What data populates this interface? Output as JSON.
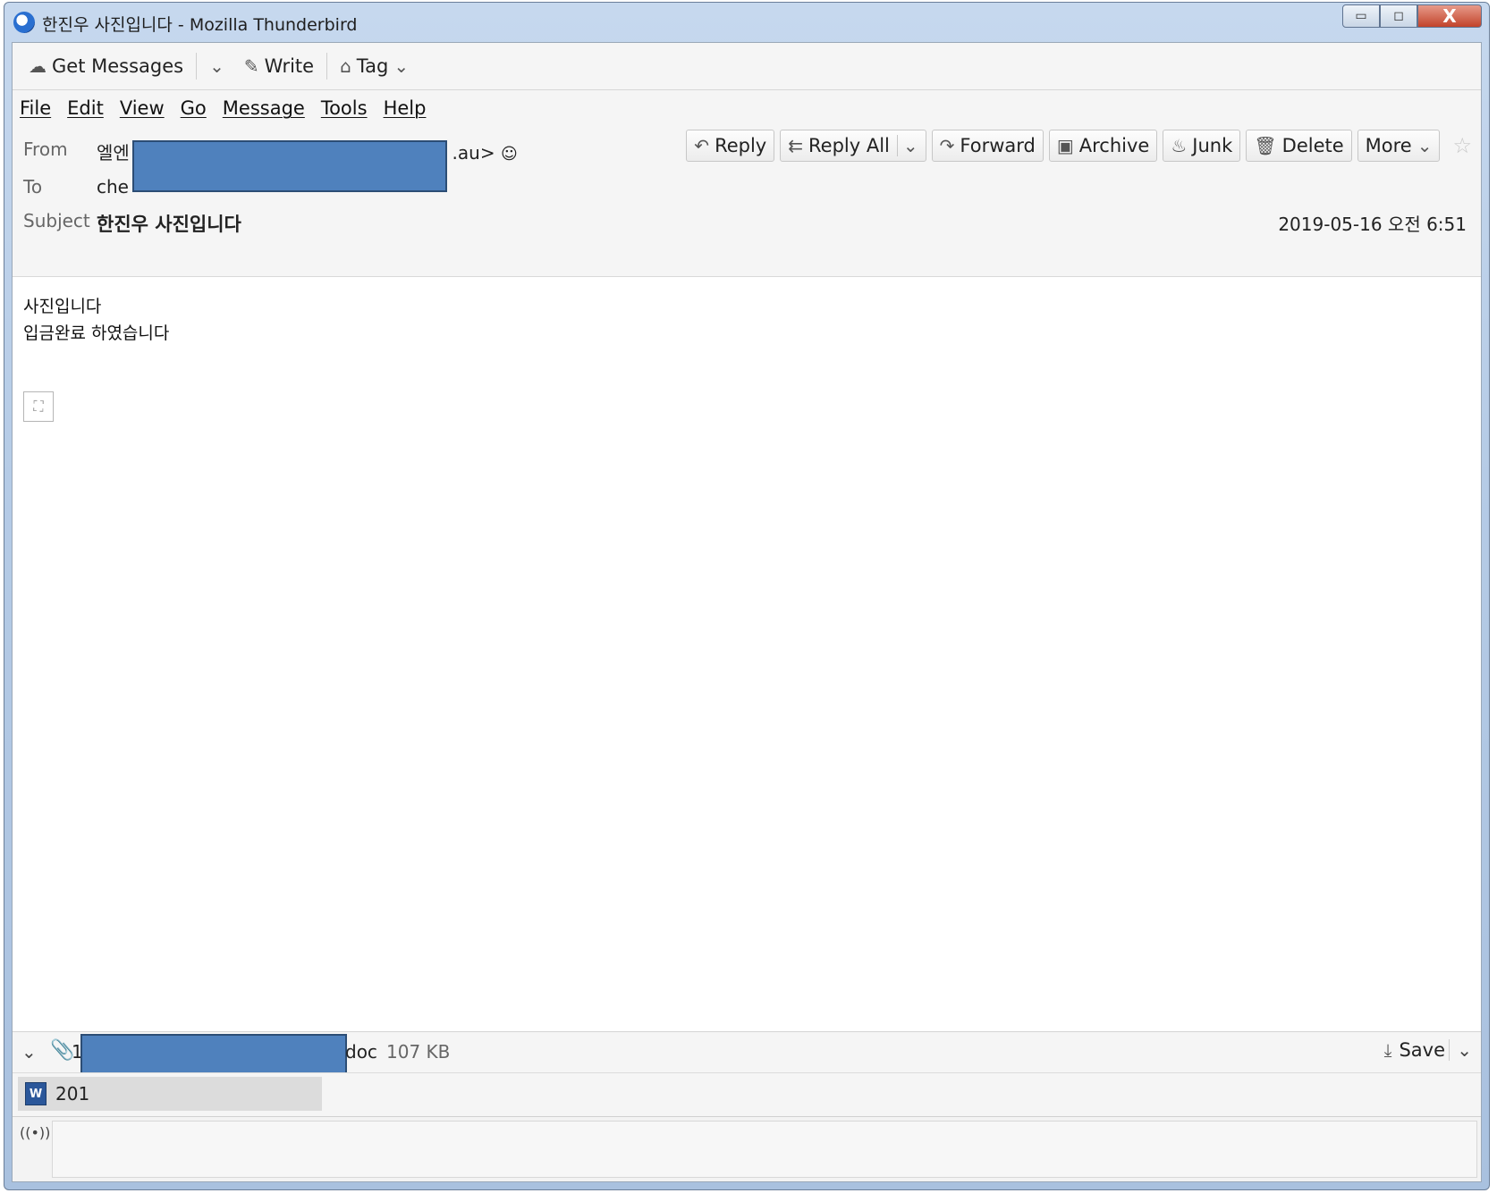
{
  "window": {
    "title": "한진우 사진입니다 - Mozilla Thunderbird",
    "controls": {
      "minimize": "▭",
      "maximize": "◻",
      "close": "X"
    }
  },
  "toolbar": {
    "get_messages": "Get Messages",
    "write": "Write",
    "tag": "Tag"
  },
  "menu": [
    "File",
    "Edit",
    "View",
    "Go",
    "Message",
    "Tools",
    "Help"
  ],
  "header": {
    "from_label": "From",
    "from_value_visible_prefix": "엘엔",
    "from_value_visible_suffix": ".au>",
    "to_label": "To",
    "to_value_visible_prefix": "che",
    "subject_label": "Subject",
    "subject_value": "한진우 사진입니다",
    "date": "2019-05-16 오전 6:51"
  },
  "actions": {
    "reply": "Reply",
    "reply_all": "Reply All",
    "forward": "Forward",
    "archive": "Archive",
    "junk": "Junk",
    "delete": "Delete",
    "more": "More"
  },
  "body": {
    "lines": [
      "사진입니다",
      "입금완료 하였습니다"
    ]
  },
  "attachments": {
    "count_prefix": "1",
    "name_suffix": "doc",
    "size": "107 KB",
    "save_label": "Save",
    "item_label_prefix": "201"
  },
  "colors": {
    "redaction": "#4f81bd",
    "window_frame": "#b5cbe6",
    "word_icon": "#2b579a"
  },
  "icons": {
    "get_messages": "cloud-download-icon",
    "write": "pencil-icon",
    "tag": "tag-icon",
    "reply": "reply-arrow-icon",
    "reply_all": "reply-all-arrow-icon",
    "forward": "forward-arrow-icon",
    "archive": "archive-box-icon",
    "junk": "flame-icon",
    "delete": "trash-icon",
    "star": "star-icon",
    "attachment": "paperclip-icon",
    "save": "download-icon",
    "status": "wireless-signal-icon"
  }
}
